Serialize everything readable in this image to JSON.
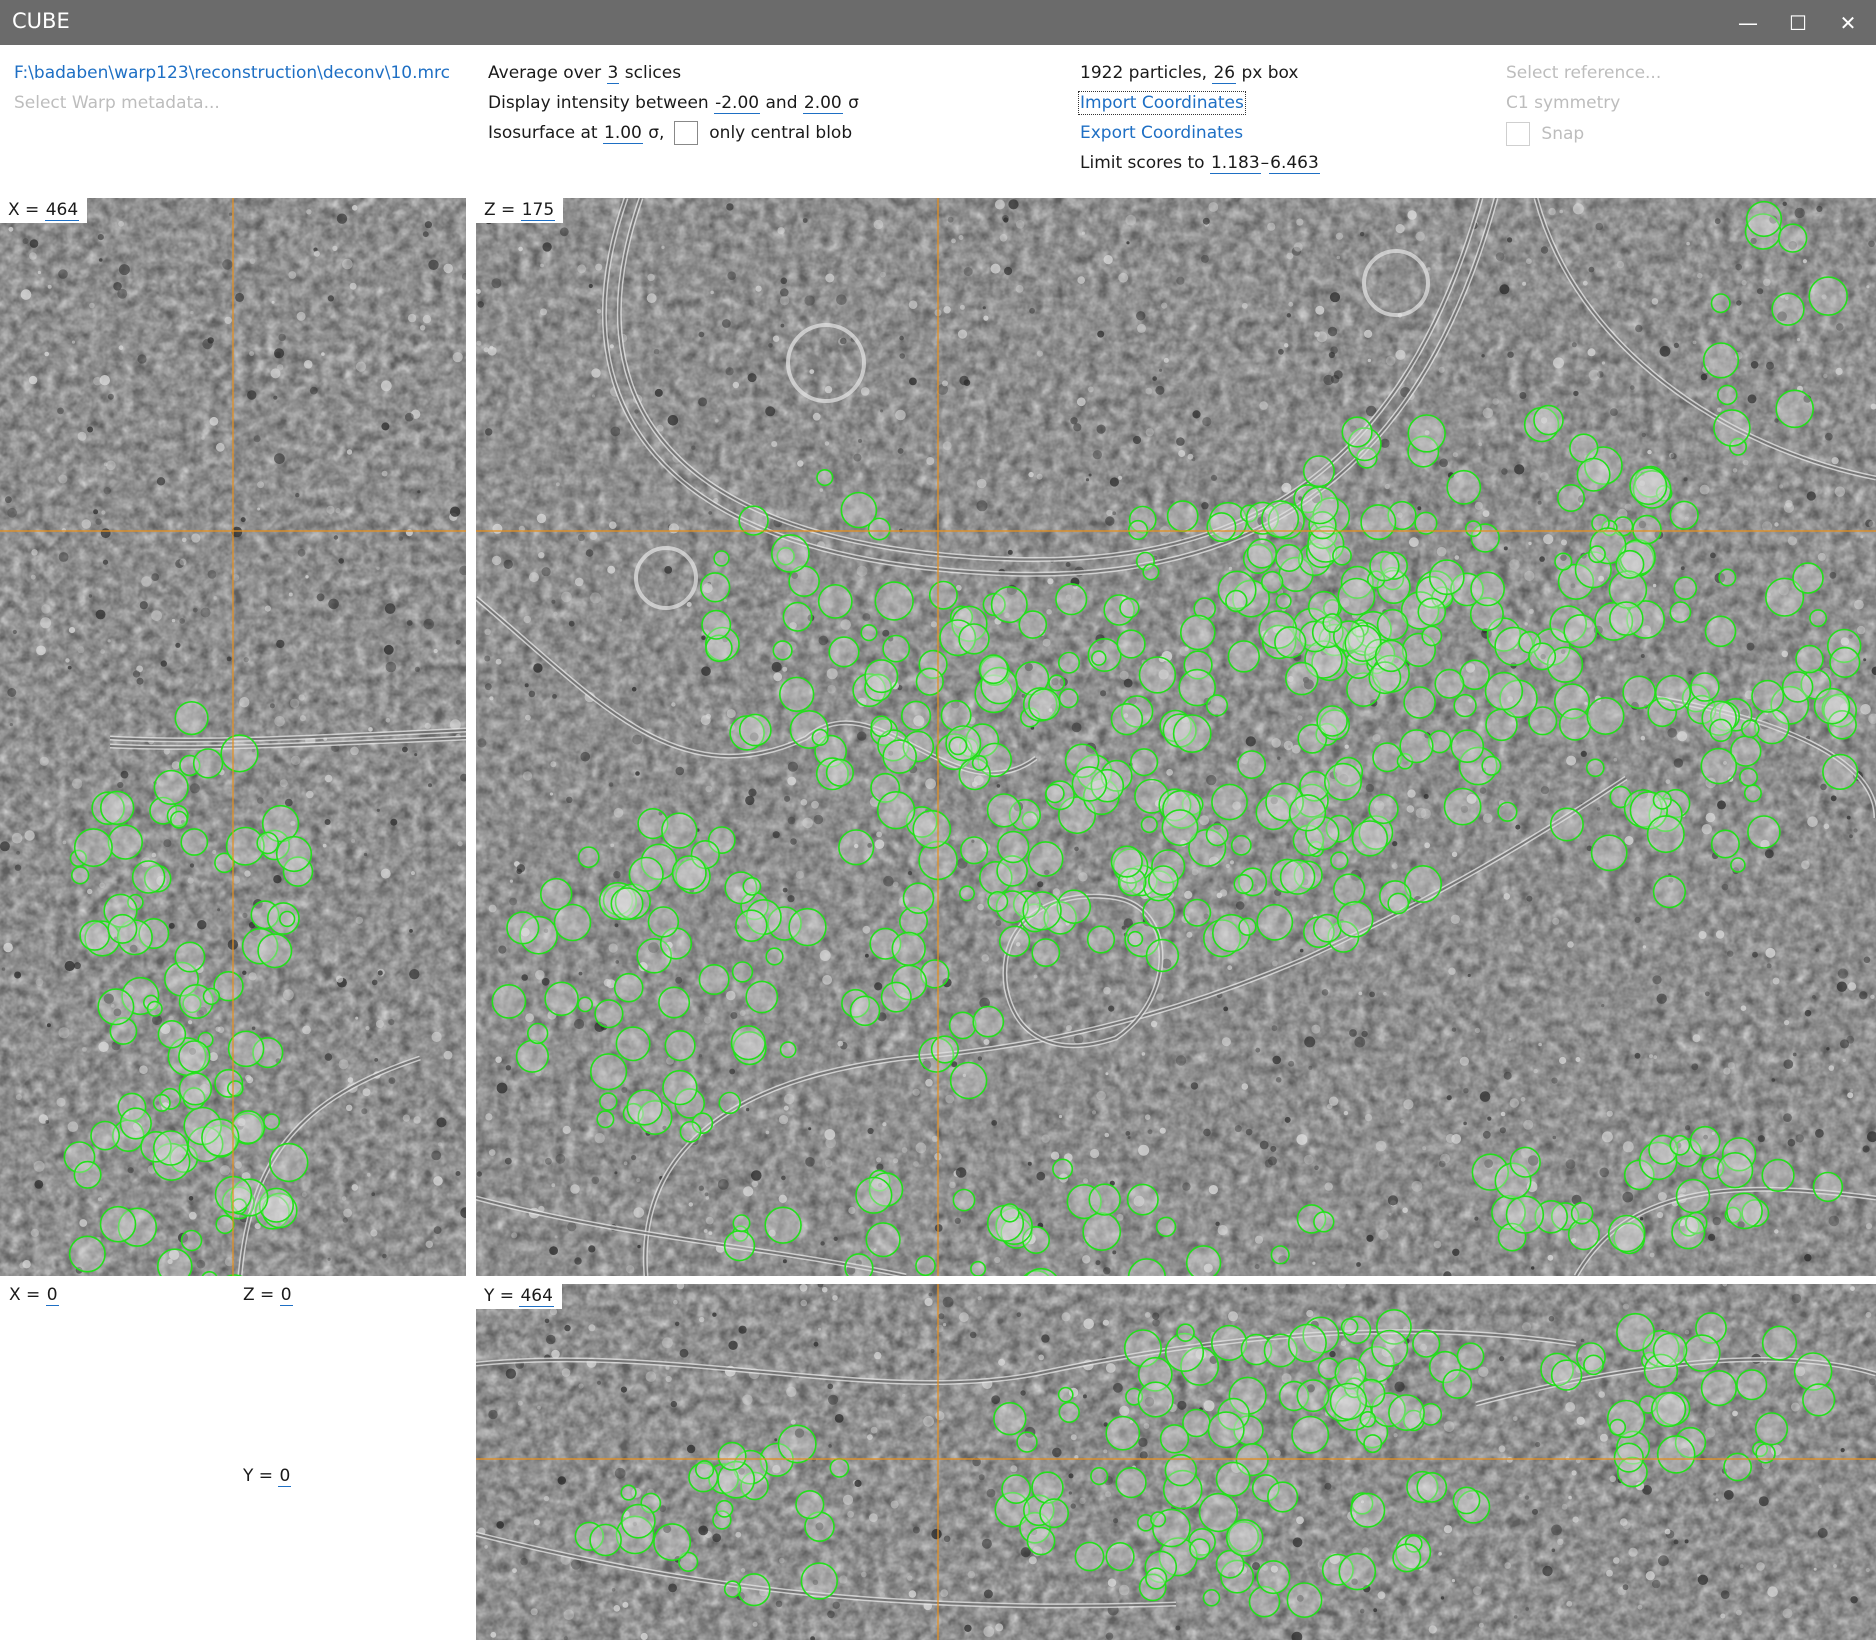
{
  "window": {
    "title": "CUBE"
  },
  "window_controls": {
    "minimize": "—",
    "maximize": "☐",
    "close": "✕"
  },
  "file": {
    "path": "F:\\badaben\\warp123\\reconstruction\\deconv\\10.mrc",
    "warp_metadata_placeholder": "Select Warp metadata..."
  },
  "display": {
    "average_prefix": "Average over",
    "average_slices": "3",
    "average_suffix": "sclices",
    "intensity_prefix": "Display intensity between",
    "intensity_min": "-2.00",
    "intensity_and": "and",
    "intensity_max": "2.00",
    "intensity_unit": "σ",
    "isosurface_prefix": "Isosurface at",
    "isosurface_value": "1.00",
    "isosurface_unit": "σ,",
    "central_blob_label": "only central blob"
  },
  "particles": {
    "count_text": "1922 particles,",
    "box_size": "26",
    "box_suffix": "px box",
    "import_label": "Import Coordinates",
    "export_label": "Export Coordinates",
    "limit_prefix": "Limit scores to",
    "score_min": "1.183",
    "score_dash": "–",
    "score_max": "6.463"
  },
  "reference": {
    "select_placeholder": "Select reference...",
    "symmetry": "C1 symmetry",
    "snap_label": "Snap"
  },
  "views": {
    "x_view": {
      "axis": "X =",
      "value": "464"
    },
    "z_view": {
      "axis": "Z =",
      "value": "175"
    },
    "y_view": {
      "axis": "Y =",
      "value": "464"
    }
  },
  "cursor_readout": {
    "x_axis": "X =",
    "x_value": "0",
    "z_axis": "Z =",
    "z_value": "0",
    "y_axis": "Y =",
    "y_value": "0"
  },
  "colors": {
    "titlebar": "#6b6b6b",
    "link": "#1e6fc4",
    "particle_circle": "#22e01a",
    "crosshair": "#e8901c"
  },
  "icons": {
    "minimize": "minimize-icon",
    "maximize": "maximize-icon",
    "close": "close-icon"
  }
}
